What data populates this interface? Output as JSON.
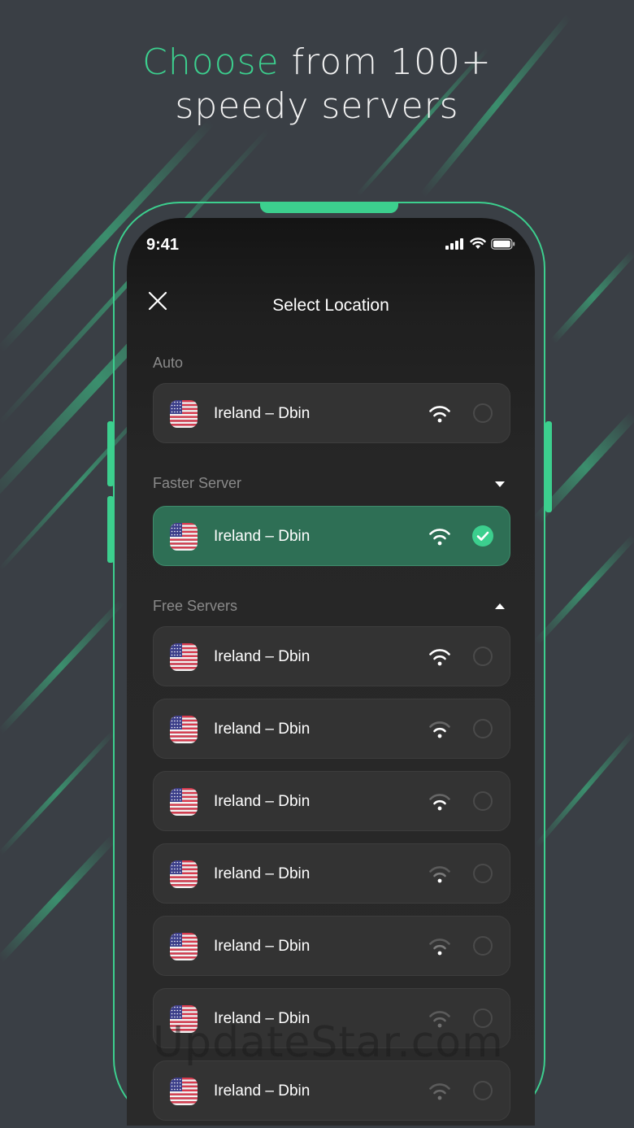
{
  "headline": {
    "accent": "Choose",
    "rest": "from 100+",
    "line2": "speedy servers"
  },
  "status_bar": {
    "time": "9:41"
  },
  "nav": {
    "title": "Select Location"
  },
  "sections": {
    "auto": "Auto",
    "faster": "Faster Server",
    "free": "Free Servers"
  },
  "auto_server": {
    "label": "Ireland – Dbin",
    "signal": "strong",
    "selected": false
  },
  "faster_server": {
    "label": "Ireland – Dbin",
    "signal": "strong",
    "selected": true
  },
  "free_servers": [
    {
      "label": "Ireland – Dbin",
      "signal": "strong",
      "selected": false
    },
    {
      "label": "Ireland – Dbin",
      "signal": "medium",
      "selected": false
    },
    {
      "label": "Ireland – Dbin",
      "signal": "medium",
      "selected": false
    },
    {
      "label": "Ireland – Dbin",
      "signal": "weak",
      "selected": false
    },
    {
      "label": "Ireland – Dbin",
      "signal": "weak",
      "selected": false
    },
    {
      "label": "Ireland – Dbin",
      "signal": "very-weak",
      "selected": false
    },
    {
      "label": "Ireland – Dbin",
      "signal": "very-weak",
      "selected": false
    }
  ],
  "watermark": "UpdateStar.com",
  "colors": {
    "accent": "#3ccf8e",
    "selected_row": "#2e6f55",
    "background": "#3a3f45",
    "row": "#333333"
  },
  "icons": {
    "close": "close-icon",
    "flag": "us-flag-icon",
    "signal": "wifi-icon",
    "check": "check-circle-icon",
    "expand": "caret-down-icon",
    "collapse": "caret-up-icon"
  }
}
